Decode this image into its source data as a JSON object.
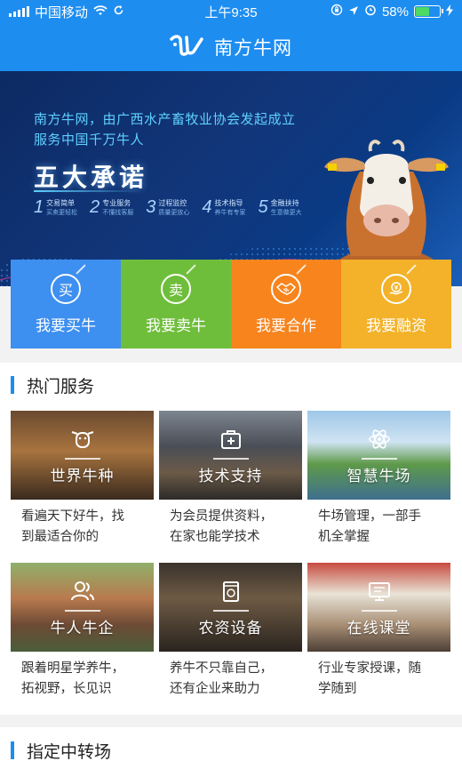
{
  "status": {
    "carrier": "中国移动",
    "time": "上午9:35",
    "battery": "58%",
    "battery_level": 0.58
  },
  "header": {
    "title": "南方牛网"
  },
  "banner": {
    "line1": "南方牛网，由广西水产畜牧业协会发起成立",
    "line2": "服务中国千万牛人",
    "headline": "五大承诺",
    "promises": [
      {
        "num": "1",
        "title": "交易简单",
        "sub": "买卖更轻松"
      },
      {
        "num": "2",
        "title": "专业服务",
        "sub": "不懂找客服"
      },
      {
        "num": "3",
        "title": "过程监控",
        "sub": "质量更放心"
      },
      {
        "num": "4",
        "title": "技术指导",
        "sub": "养牛有专家"
      },
      {
        "num": "5",
        "title": "金融扶持",
        "sub": "生意做更大"
      }
    ],
    "slides": 3,
    "active_slide": 1
  },
  "actions": [
    {
      "icon": "买",
      "label": "我要买牛",
      "color": "#3d8ff0"
    },
    {
      "icon": "卖",
      "label": "我要卖牛",
      "color": "#6fbe3b"
    },
    {
      "icon": "handshake",
      "label": "我要合作",
      "color": "#f7841d"
    },
    {
      "icon": "finance",
      "label": "我要融资",
      "color": "#f3b229"
    }
  ],
  "hot_services": {
    "title": "热门服务",
    "items": [
      {
        "name": "世界牛种",
        "desc1": "看遍天下好牛，找",
        "desc2": "到最适合你的"
      },
      {
        "name": "技术支持",
        "desc1": "为会员提供资料，",
        "desc2": "在家也能学技术"
      },
      {
        "name": "智慧牛场",
        "desc1": "牛场管理，一部手",
        "desc2": "机全掌握"
      },
      {
        "name": "牛人牛企",
        "desc1": "跟着明星学养牛，",
        "desc2": "拓视野，长见识"
      },
      {
        "name": "农资设备",
        "desc1": "养牛不只靠自己，",
        "desc2": "还有企业来助力"
      },
      {
        "name": "在线课堂",
        "desc1": "行业专家授课，随",
        "desc2": "学随到"
      }
    ]
  },
  "transfer": {
    "title": "指定中转场"
  }
}
